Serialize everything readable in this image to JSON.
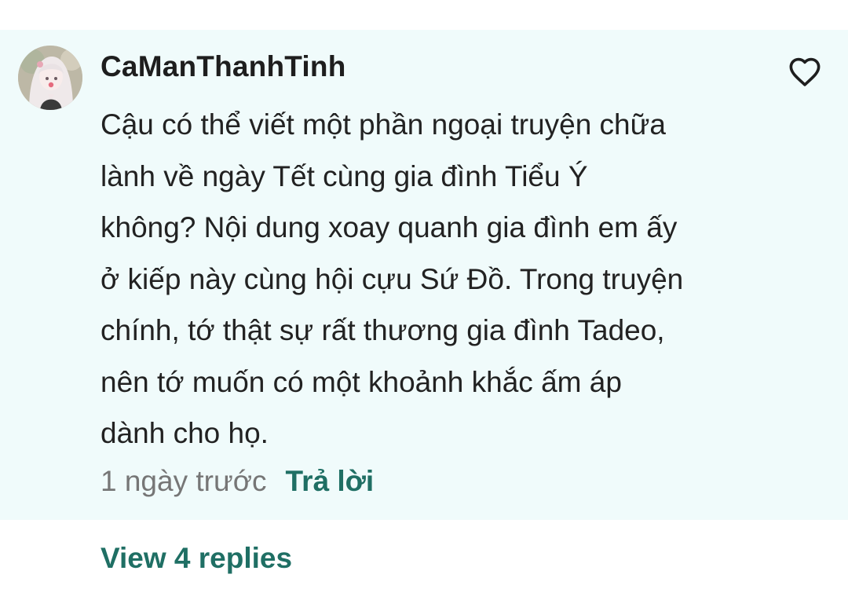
{
  "comment": {
    "username": "CaManThanhTinh",
    "avatar_icon": "avatar-anime-girl",
    "like_icon": "heart-outline-icon",
    "lines": [
      "Cậu có thể viết một phần ngoại truyện chữa",
      "lành về ngày Tết cùng gia đình Tiểu Ý",
      "không? Nội dung xoay quanh gia đình em ấy",
      "ở kiếp này cùng hội cựu Sứ Đồ. Trong truyện",
      "chính, tớ thật sự rất thương gia đình Tadeo,",
      "nên tớ muốn có một khoảnh khắc ấm áp",
      "dành cho họ."
    ],
    "timestamp": "1 ngày trước",
    "reply_label": "Trả lời"
  },
  "replies": {
    "view_label": "View 4 replies"
  },
  "colors": {
    "card_background": "#f0fbfb",
    "accent": "#1f6f64",
    "muted_text": "#767676",
    "body_text": "#222222"
  }
}
